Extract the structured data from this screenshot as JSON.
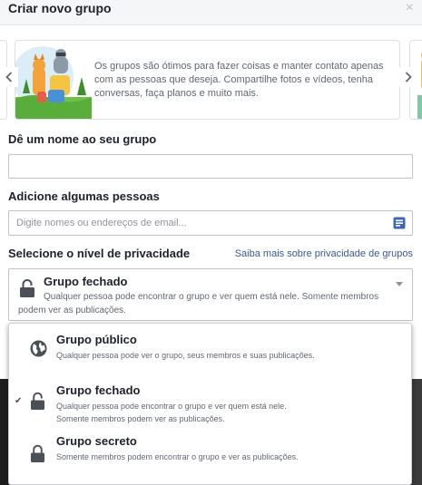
{
  "dialog": {
    "title": "Criar novo grupo",
    "close_label": "×"
  },
  "carousel": {
    "card_text": "Os grupos são ótimos para fazer coisas e manter contato apenas com as pessoas que deseja. Compartilhe fotos e vídeos, tenha conversas, faça planos e muito mais."
  },
  "name_section": {
    "label": "Dê um nome ao seu grupo",
    "value": "",
    "placeholder": ""
  },
  "members_section": {
    "label": "Adicione algumas pessoas",
    "value": "",
    "placeholder": "Digite nomes ou endereços de email..."
  },
  "privacy_section": {
    "label": "Selecione o nível de privacidade",
    "link": "Saiba mais sobre privacidade de grupos",
    "selected": {
      "title": "Grupo fechado",
      "desc_line1": "Qualquer pessoa pode encontrar o grupo e ver quem está nele. Somente membros",
      "desc_line2": "podem ver as publicações."
    },
    "options": [
      {
        "title": "Grupo público",
        "desc": "Qualquer pessoa pode ver o grupo, seus membros e suas publicações.",
        "icon": "globe-icon",
        "checked": false
      },
      {
        "title": "Grupo fechado",
        "desc": "Qualquer pessoa pode encontrar o grupo e ver quem está nele. Somente membros podem ver as publicações.",
        "icon": "lock-icon",
        "checked": true
      },
      {
        "title": "Grupo secreto",
        "desc": "Somente membros podem encontrar o grupo e ver as publicações.",
        "icon": "lock-icon",
        "checked": false
      }
    ],
    "check_mark": "✔"
  },
  "colors": {
    "accent": "#385898",
    "title": "#1d2129",
    "secondary": "#606770",
    "border": "#bec3c9",
    "messenger_blue": "#4267b2"
  }
}
